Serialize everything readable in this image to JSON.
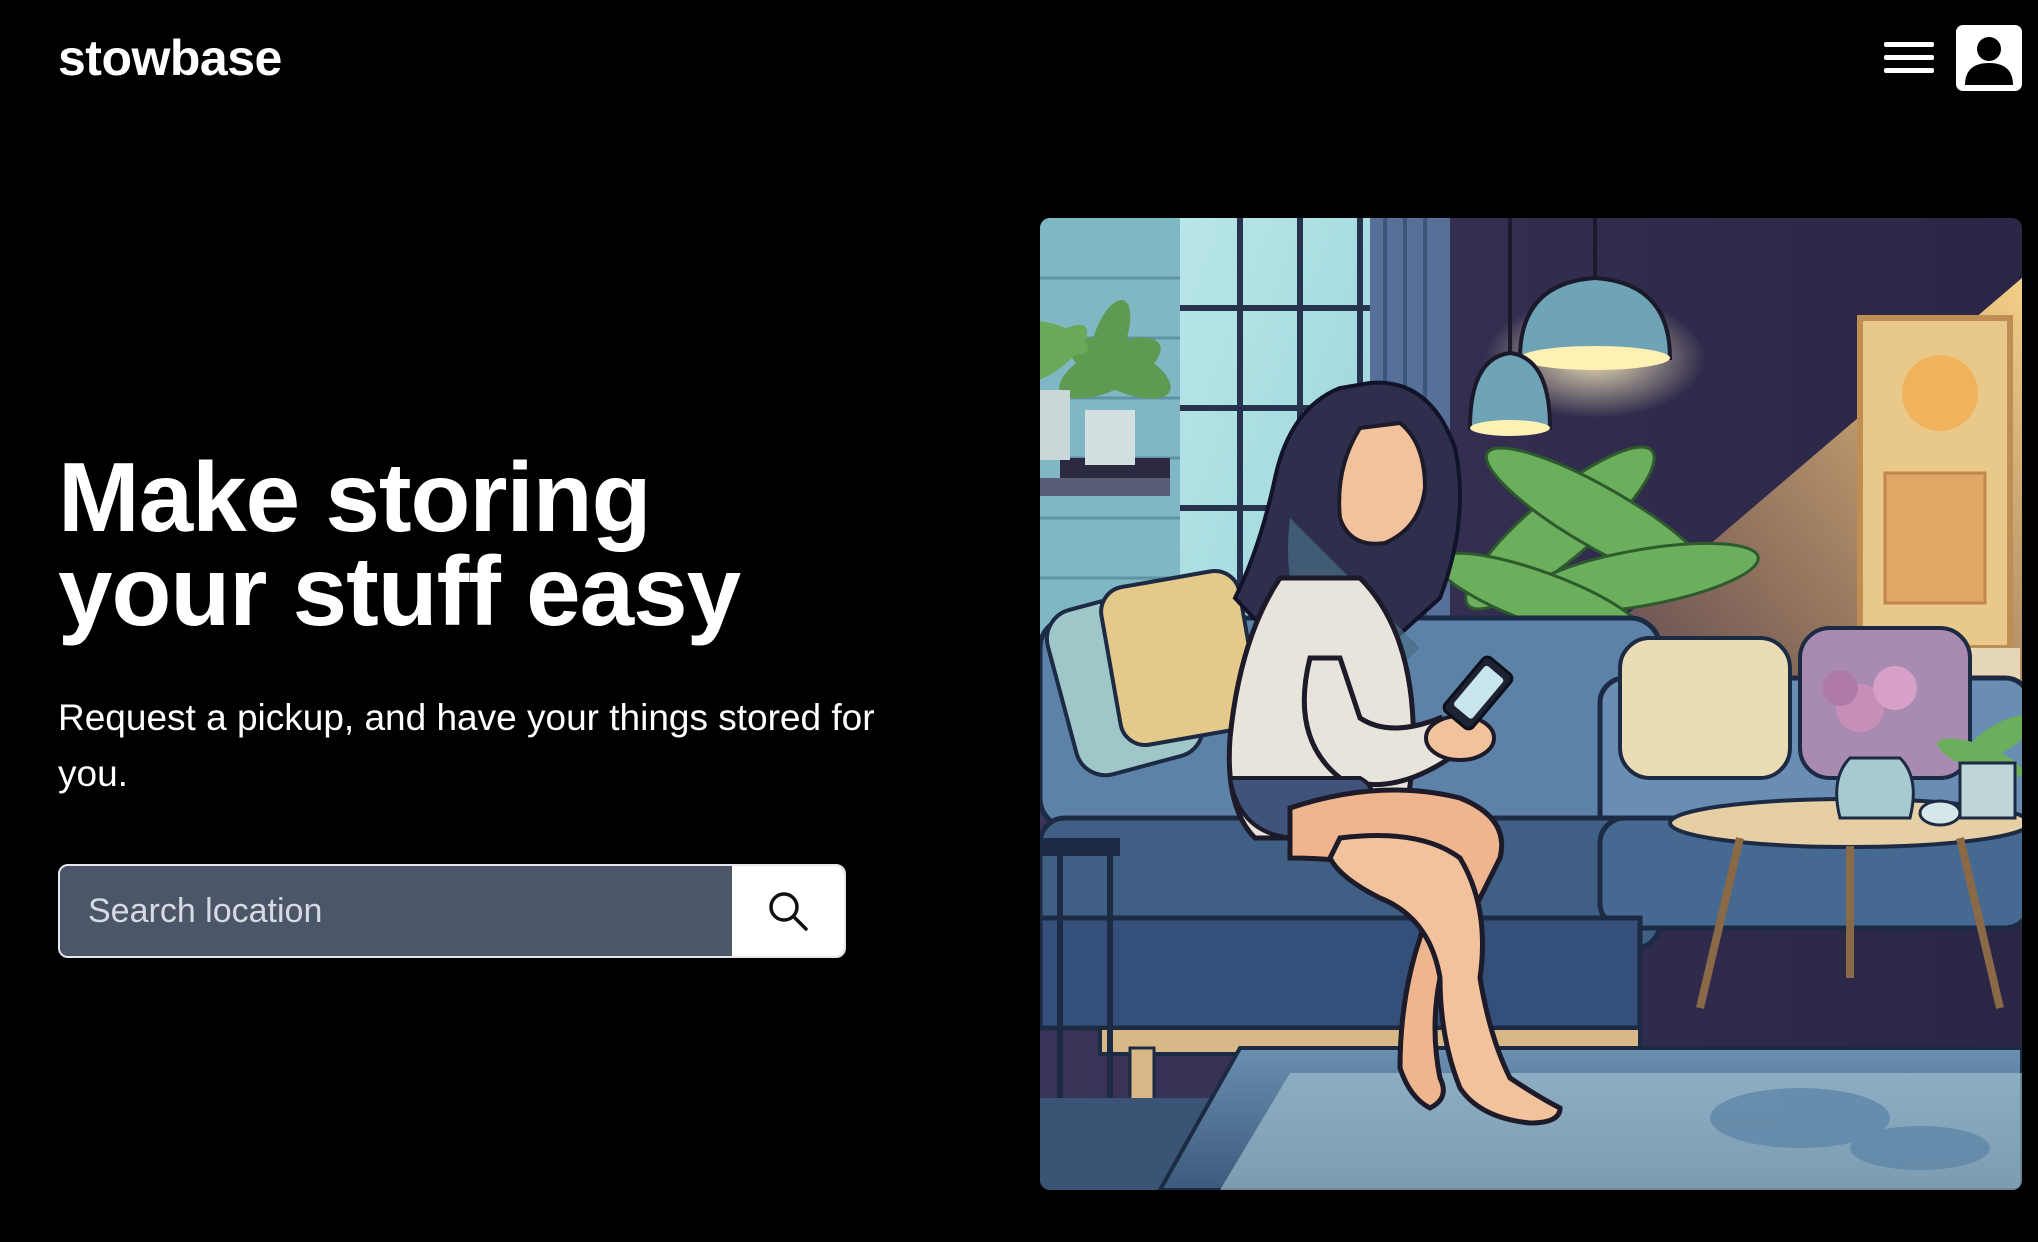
{
  "header": {
    "logo": "stowbase",
    "menu_icon": "hamburger-menu-icon",
    "user_icon": "user-account-icon"
  },
  "hero": {
    "title_line1": "Make storing",
    "title_line2": "your stuff easy",
    "subtitle": "Request a pickup, and have your things stored for you."
  },
  "search": {
    "placeholder": "Search location",
    "value": "",
    "button_icon": "search-icon"
  },
  "illustration": {
    "subject": "woman-on-sofa-using-phone-illustration"
  },
  "colors": {
    "background": "#000000",
    "text": "#ffffff",
    "search_field": "#4b5668",
    "search_button": "#ffffff"
  }
}
